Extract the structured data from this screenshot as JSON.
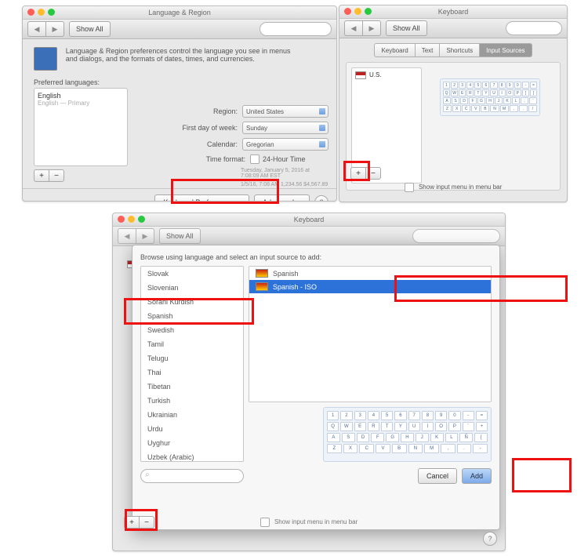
{
  "panel1": {
    "title": "Language & Region",
    "show_all": "Show All",
    "desc": "Language & Region preferences control the language you see in menus and dialogs, and the formats of dates, times, and currencies.",
    "pref_label": "Preferred languages:",
    "lang_primary": "English",
    "lang_sub": "English — Primary",
    "region_label": "Region:",
    "region_value": "United States",
    "fdow_label": "First day of week:",
    "fdow_value": "Sunday",
    "calendar_label": "Calendar:",
    "calendar_value": "Gregorian",
    "timefmt_label": "Time format:",
    "timefmt_value": "24-Hour Time",
    "sample1": "Tuesday, January 5, 2016 at 7:08:09 AM EST",
    "sample2": "1/5/16,  7:08 AM    1,234.56    $4,567.89",
    "kbpref_btn": "Keyboard Preferences…",
    "advanced_btn": "Advanced…",
    "help": "?"
  },
  "panel2": {
    "title": "Keyboard",
    "show_all": "Show All",
    "tabs": [
      "Keyboard",
      "Text",
      "Shortcuts",
      "Input Sources"
    ],
    "source_us": "U.S.",
    "show_menu": "Show input menu in menu bar"
  },
  "panel3": {
    "title": "Keyboard",
    "show_all": "Show All",
    "browse": "Browse using language and select an input source to add:",
    "languages": [
      "Slovak",
      "Slovenian",
      "Sorani Kurdish",
      "Spanish",
      "Swedish",
      "Tamil",
      "Telugu",
      "Thai",
      "Tibetan",
      "Turkish",
      "Ukrainian",
      "Urdu",
      "Uyghur",
      "Uzbek (Arabic)"
    ],
    "selected_language": "Spanish",
    "sources": [
      {
        "label": "Spanish",
        "selected": false
      },
      {
        "label": "Spanish - ISO",
        "selected": true
      }
    ],
    "cancel": "Cancel",
    "add": "Add",
    "show_menu": "Show input menu in menu bar",
    "help": "?"
  }
}
